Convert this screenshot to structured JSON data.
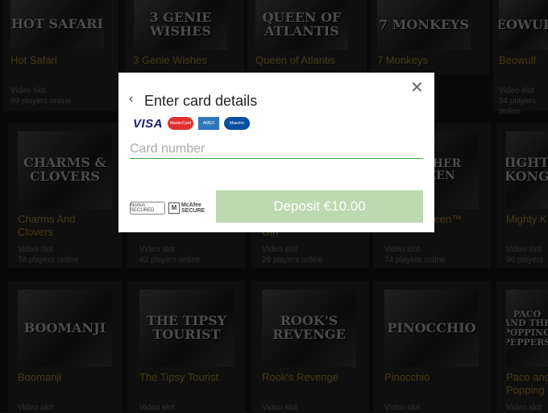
{
  "games": [
    {
      "name": "Hot Safari",
      "type": "Video slot",
      "players": "99 players online",
      "art": "Hot Safari"
    },
    {
      "name": "3 Genie Wishes",
      "type": "",
      "players": "",
      "art": "3 Genie Wishes"
    },
    {
      "name": "Queen of Atlantis",
      "type": "",
      "players": "",
      "art": "Queen of Atlantis"
    },
    {
      "name": "7 Monkeys",
      "type": "",
      "players": "",
      "art": "7 Monkeys"
    },
    {
      "name": "Beowulf",
      "type": "Video slot",
      "players": "34 players online",
      "art": "Beowulf"
    },
    {
      "name": "Charms And Clovers",
      "type": "Video slot",
      "players": "74 players online",
      "art": "Charms & Clovers"
    },
    {
      "name": "",
      "type": "Video slot",
      "players": "43 players online",
      "art": ""
    },
    {
      "name": "",
      "type": "Video slot",
      "players": "29 players online",
      "art": ""
    },
    {
      "name": "",
      "type": "Video slot",
      "players": "74 players online",
      "art": ""
    },
    {
      "name": "Mighty K",
      "type": "Video slot",
      "players": "96 players",
      "art": "Mighty Kong"
    },
    {
      "name": "Boomanji",
      "type": "Video slot",
      "players": "",
      "art": "Boomanji"
    },
    {
      "name": "The Tipsy Tourist",
      "type": "Video slot",
      "players": "",
      "art": "The Tipsy Tourist"
    },
    {
      "name": "Rook's Revenge",
      "type": "Video slot",
      "players": "",
      "art": "Rook's Revenge"
    },
    {
      "name": "Pinocchio",
      "type": "Video slot",
      "players": "",
      "art": "Pinocchio"
    },
    {
      "name": "Paco and Popping",
      "type": "Video slot",
      "players": "",
      "art": "Paco and the Popping Peppers"
    }
  ],
  "partial_texts": {
    "row2_col4_name": "ueen™",
    "row2_col3_name": "Girl"
  },
  "modal": {
    "back_label": "‹",
    "title": "Enter card details",
    "close_label": "✕",
    "logos": {
      "visa": "VISA",
      "mastercard": "MasterCard",
      "amex": "AMEX",
      "maestro": "Maestro"
    },
    "card_placeholder": "Card number",
    "seals": {
      "norton": "Norton SECURED",
      "mcafee_line1": "McAfee",
      "mcafee_line2": "SECURE"
    },
    "deposit_label": "Deposit €10.00"
  },
  "colors": {
    "accent": "#3aa83a",
    "deposit_bg": "#bcd9b2",
    "game_name": "#c9a227"
  }
}
